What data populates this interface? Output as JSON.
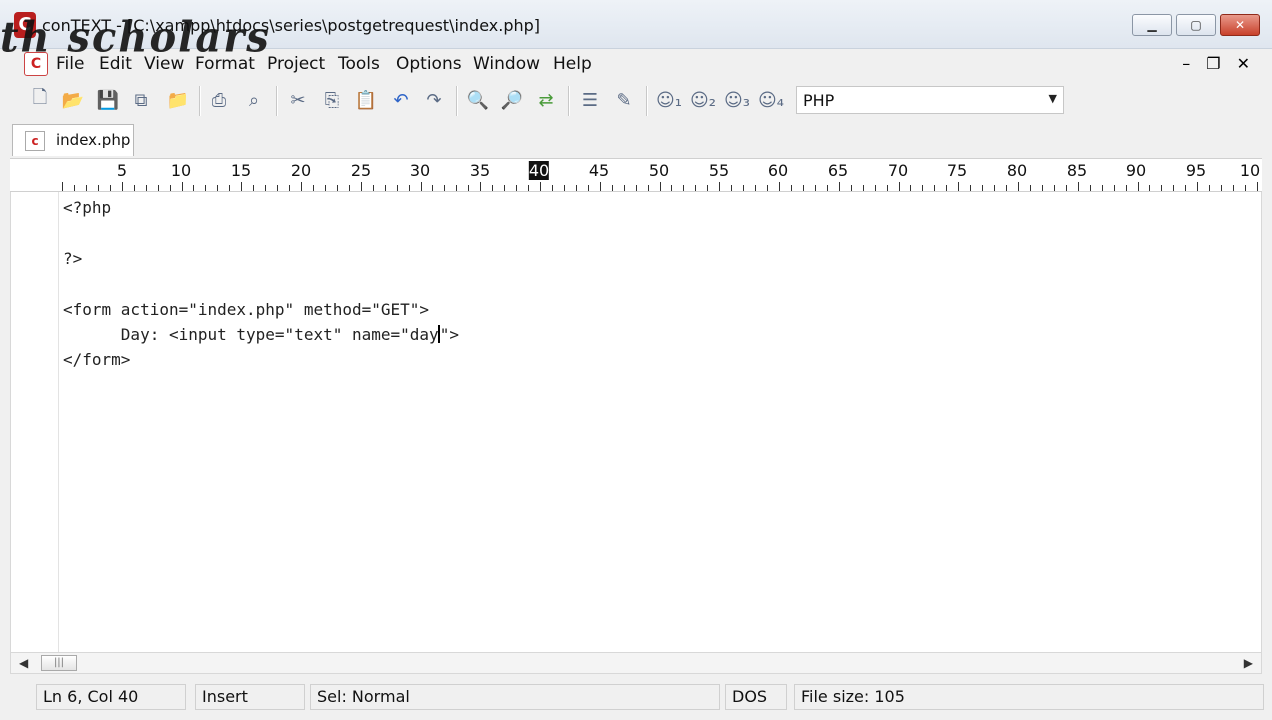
{
  "window": {
    "title": "conTEXT - [C:\\xampp\\htdocs\\series\\postgetrequest\\index.php]",
    "watermark": "th scholars",
    "logo_letter": "C"
  },
  "menu": [
    "File",
    "Edit",
    "View",
    "Format",
    "Project",
    "Tools",
    "Options",
    "Window",
    "Help"
  ],
  "mdi": {
    "minimize": "–",
    "restore": "❐",
    "close": "✕"
  },
  "toolbar": {
    "icons": [
      "new-file-icon",
      "open-folder-icon",
      "save-icon",
      "save-all-icon",
      "open-project-icon",
      "print-icon",
      "print-preview-icon",
      "cut-icon",
      "copy-icon",
      "paste-icon",
      "undo-icon",
      "redo-icon",
      "find-icon",
      "find-next-icon",
      "replace-icon",
      "file-info-icon",
      "settings-icon",
      "user-1-icon",
      "user-2-icon",
      "user-3-icon",
      "user-4-icon"
    ],
    "language": "PHP"
  },
  "tab": {
    "label": "index.php"
  },
  "ruler": {
    "numbers": [
      "5",
      "10",
      "15",
      "20",
      "25",
      "30",
      "35",
      "40",
      "45",
      "50",
      "55",
      "60",
      "65",
      "70",
      "75",
      "80",
      "85",
      "90",
      "95",
      "10"
    ],
    "current_column": "40"
  },
  "code": {
    "line1": "<?php",
    "line2": "",
    "line3": "?>",
    "line4": "",
    "line5": "<form action=\"index.php\" method=\"GET\">",
    "line6_before_caret": "      Day: <input type=\"text\" name=\"day",
    "line6_after_caret": "\">",
    "line7": "</form>"
  },
  "status": {
    "position": "Ln 6, Col 40",
    "mode": "Insert",
    "selection": "Sel: Normal",
    "line_ending": "DOS",
    "file_size": "File size: 105"
  },
  "colors": {
    "close_button": "#c8412b",
    "logo": "#b91e1e"
  }
}
